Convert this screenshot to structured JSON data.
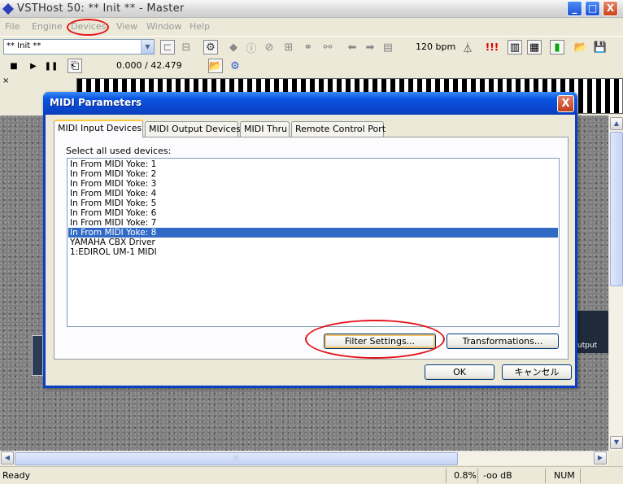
{
  "window": {
    "title": "VSTHost 50: ** Init ** - Master",
    "minimize": "_",
    "maximize": "□",
    "close": "X"
  },
  "menu": [
    {
      "label": "File"
    },
    {
      "label": "Engine"
    },
    {
      "label": "Devices"
    },
    {
      "label": "View"
    },
    {
      "label": "Window"
    },
    {
      "label": "Help"
    }
  ],
  "toolbar": {
    "preset": "** Init **",
    "bpm": "120 bpm",
    "time": "0.000 / 42.479",
    "exclaim": "!!!"
  },
  "dialog": {
    "title": "MIDI Parameters",
    "close": "X",
    "tabs": [
      {
        "label": "MIDI Input Devices"
      },
      {
        "label": "MIDI Output Devices"
      },
      {
        "label": "MIDI Thru"
      },
      {
        "label": "Remote Control Port"
      }
    ],
    "prompt": "Select all used devices:",
    "devices": [
      {
        "label": "In From MIDI Yoke:  1"
      },
      {
        "label": "In From MIDI Yoke:  2"
      },
      {
        "label": "In From MIDI Yoke:  3"
      },
      {
        "label": "In From MIDI Yoke:  4"
      },
      {
        "label": "In From MIDI Yoke:  5"
      },
      {
        "label": "In From MIDI Yoke:  6"
      },
      {
        "label": "In From MIDI Yoke:  7"
      },
      {
        "label": "In From MIDI Yoke:  8"
      },
      {
        "label": "YAMAHA CBX Driver"
      },
      {
        "label": "1:EDIROL UM-1 MIDI"
      }
    ],
    "filter_button": "Filter Settings...",
    "transform_button": "Transformations...",
    "ok_button": "OK",
    "cancel_button": "キャンセル"
  },
  "workspace": {
    "plugin_label": "utput"
  },
  "status": {
    "text": "Ready",
    "cpu": "0.8%",
    "level": "-oo dB",
    "num": "NUM"
  }
}
